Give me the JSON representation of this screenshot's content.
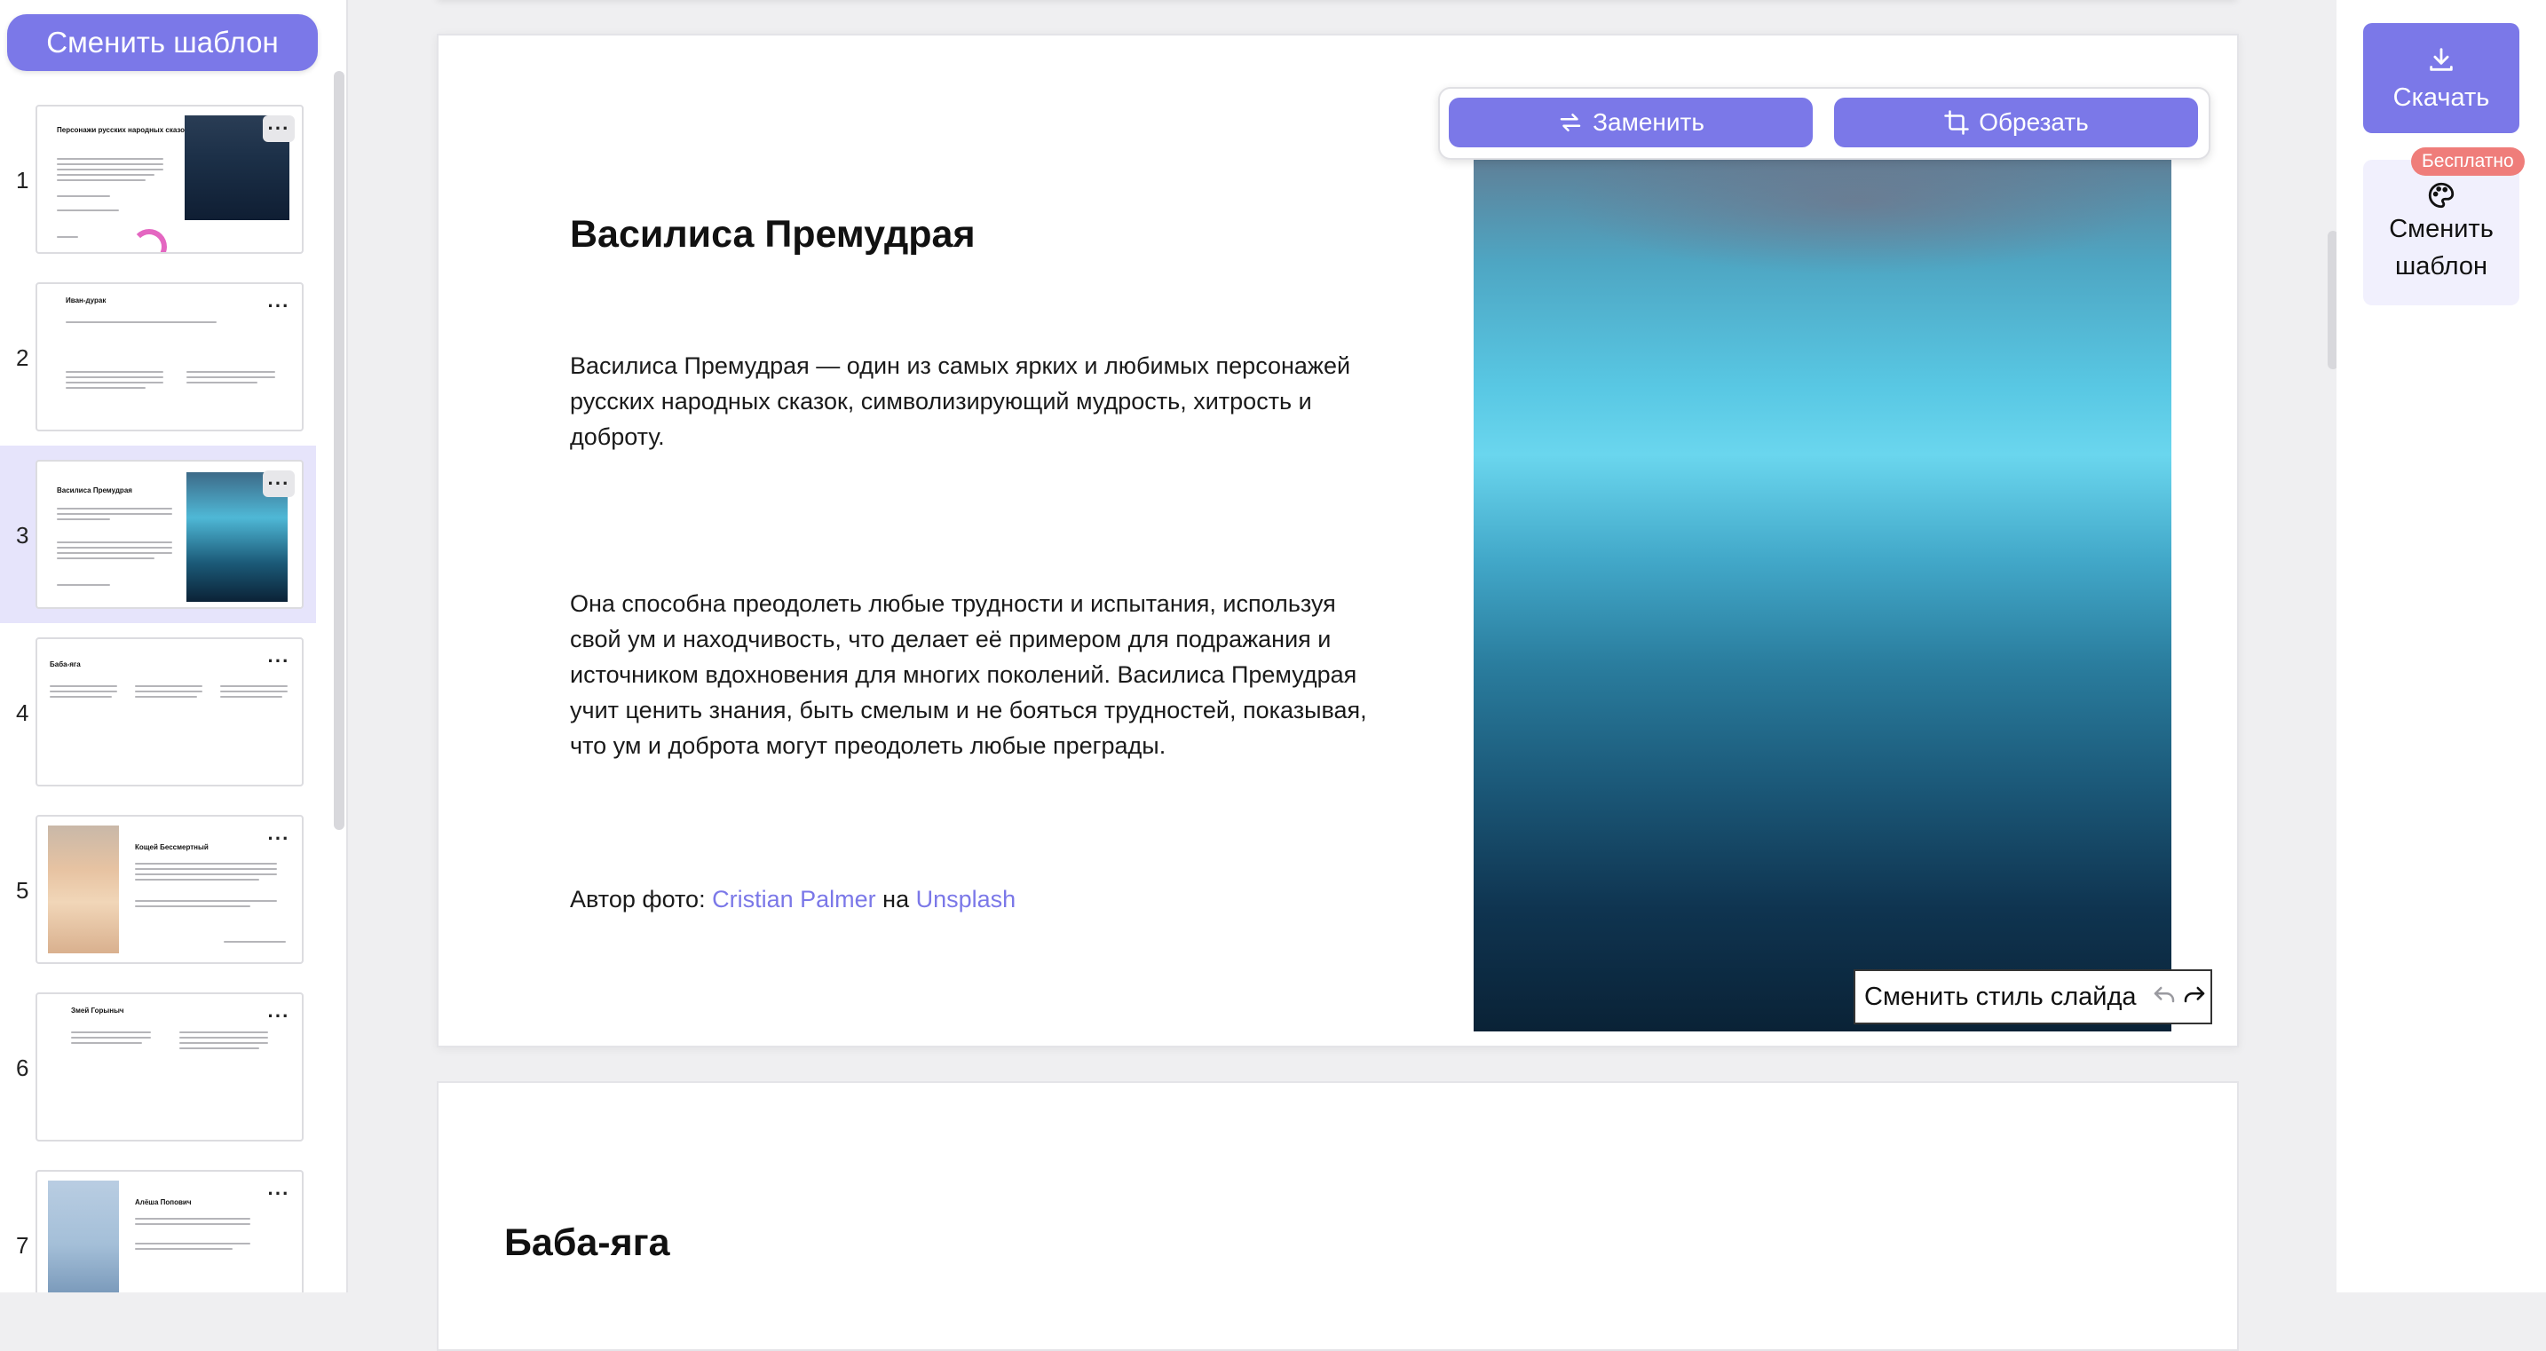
{
  "sidebar": {
    "change_template_label": "Сменить шаблон",
    "thumbnails": [
      {
        "number": "1",
        "title": "Персонажи русских народных сказок"
      },
      {
        "number": "2",
        "title": "Иван-дурак"
      },
      {
        "number": "3",
        "title": "Василиса Премудрая"
      },
      {
        "number": "4",
        "title": "Баба-яга"
      },
      {
        "number": "5",
        "title": "Кощей Бессмертный"
      },
      {
        "number": "6",
        "title": "Змей Горыныч"
      },
      {
        "number": "7",
        "title": "Алёша Попович"
      }
    ]
  },
  "slide": {
    "title": "Василиса Премудрая",
    "paragraph1": "Василиса Премудрая — один из самых ярких и любимых персонажей русских народных сказок, символизирующий мудрость, хитрость и доброту.",
    "paragraph2": "Она способна преодолеть любые трудности и испытания, используя свой ум и находчивость, что делает её примером для подражания и источником вдохновения для многих поколений. Василиса Премудрая учит ценить знания, быть смелым и не бояться трудностей, показывая, что ум и доброта могут преодолеть любые преграды.",
    "credit_prefix": "Автор фото:",
    "credit_author": "Cristian Palmer",
    "credit_on": "на",
    "credit_site": "Unsplash"
  },
  "image_toolbar": {
    "replace_label": "Заменить",
    "crop_label": "Обрезать"
  },
  "style_toolbar": {
    "label": "Сменить стиль слайда"
  },
  "next_slide": {
    "title": "Баба-яга"
  },
  "right_panel": {
    "download_label": "Скачать",
    "change_template_label": "Сменить шаблон",
    "free_badge": "Бесплатно"
  },
  "colors": {
    "accent": "#7b78e8",
    "selected_thumb_bg": "#e6e4fb",
    "badge": "#ef7d7a"
  },
  "icons": [
    "download-icon",
    "palette-icon",
    "swap-icon",
    "crop-icon",
    "undo-icon",
    "redo-icon",
    "more-options-icon"
  ]
}
